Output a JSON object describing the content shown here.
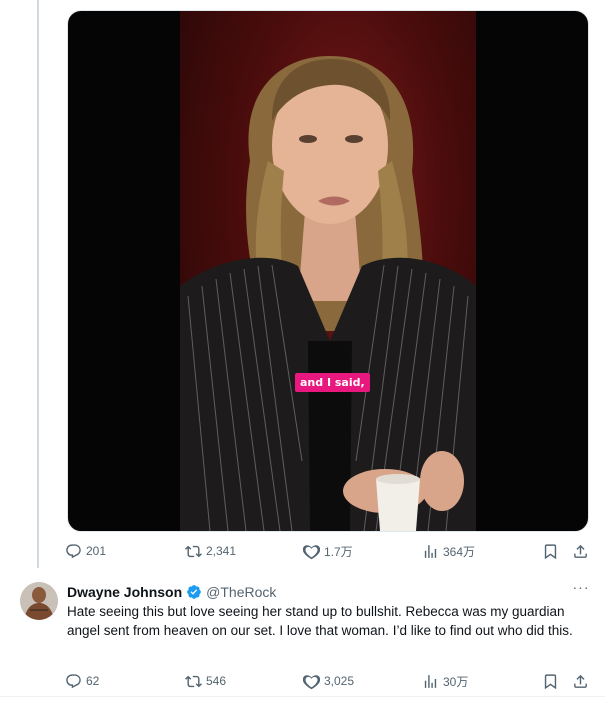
{
  "video": {
    "caption": "and I said,"
  },
  "main_tweet": {
    "stats": {
      "replies": "201",
      "retweets": "2,341",
      "likes": "1.7万",
      "views": "364万"
    }
  },
  "reply": {
    "display_name": "Dwayne Johnson",
    "handle": "@TheRock",
    "text": "Hate seeing this but love seeing her stand up to bullshit. Rebecca was my guardian angel sent from heaven on our set. I love that woman. I’d like to find out who did this.",
    "stats": {
      "replies": "62",
      "retweets": "546",
      "likes": "3,025",
      "views": "30万"
    }
  },
  "colors": {
    "text_primary": "#0f1419",
    "text_secondary": "#536471",
    "verified": "#1d9bf0",
    "caption_bg": "#e8187f",
    "thread_line": "#cfd9de"
  },
  "icons": {
    "reply": "reply-icon",
    "retweet": "retweet-icon",
    "like": "heart-icon",
    "views": "views-icon",
    "bookmark": "bookmark-icon",
    "share": "share-icon",
    "verified": "verified-badge-icon",
    "more": "more-icon"
  }
}
